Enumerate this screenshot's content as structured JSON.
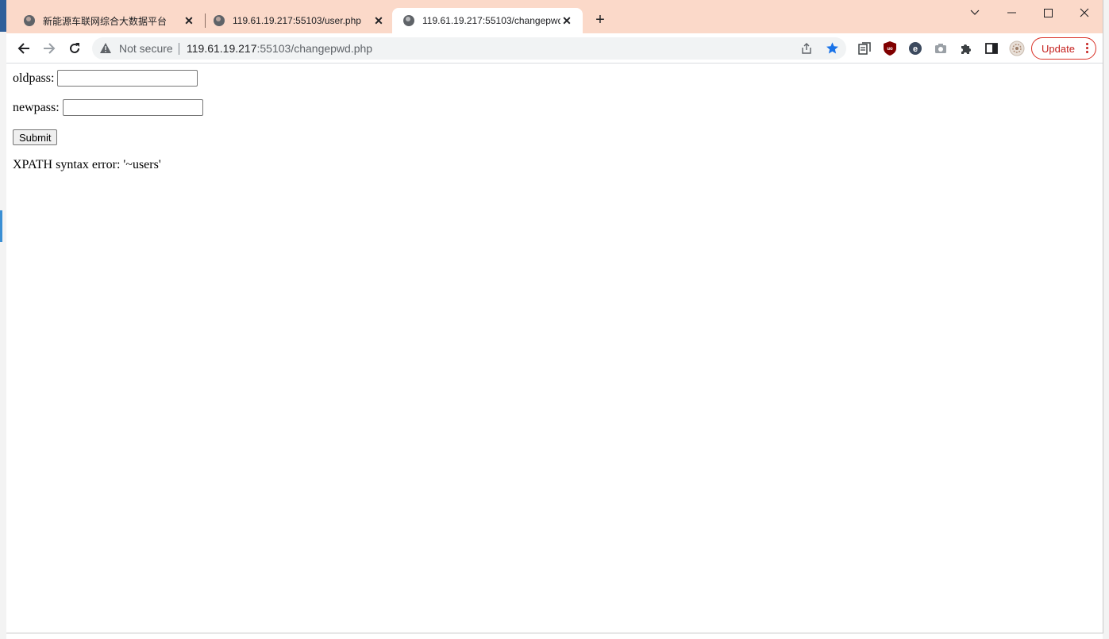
{
  "browser": {
    "tabs": [
      {
        "title": "新能源车联网综合大数据平台",
        "active": false
      },
      {
        "title": "119.61.19.217:55103/user.php",
        "active": false
      },
      {
        "title": "119.61.19.217:55103/changepwd.php",
        "active": true
      }
    ],
    "omnibox": {
      "security_label": "Not secure",
      "url_host": "119.61.19.217",
      "url_path": ":55103/changepwd.php"
    },
    "update_label": "Update",
    "colors": {
      "tabstrip": "#fbd9c9",
      "star": "#1a73e8",
      "update": "#c5221f"
    }
  },
  "form": {
    "oldpass_label": "oldpass:",
    "oldpass_value": "",
    "newpass_label": "newpass:",
    "newpass_value": "",
    "submit_label": "Submit"
  },
  "message": "XPATH syntax error: '~users'",
  "icons": [
    "globe-icon",
    "close-icon",
    "plus-icon",
    "chevron-down-icon",
    "minimize-icon",
    "maximize-icon",
    "window-close-icon",
    "back-arrow-icon",
    "forward-arrow-icon",
    "reload-icon",
    "warning-icon",
    "share-icon",
    "star-icon",
    "reading-list-icon",
    "ublock-icon",
    "extension-e-icon",
    "camera-icon",
    "puzzle-icon",
    "side-panel-icon",
    "profile-avatar-icon",
    "more-vert-icon"
  ]
}
